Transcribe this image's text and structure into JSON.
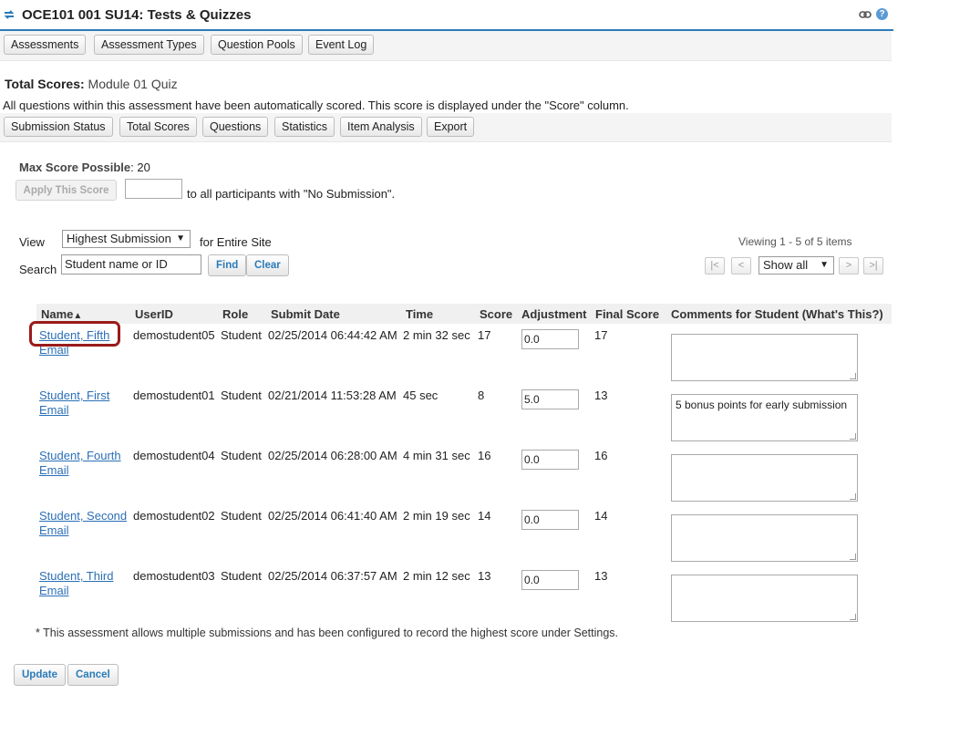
{
  "header": {
    "title": "OCE101 001 SU14: Tests & Quizzes",
    "help_label": "?"
  },
  "nav": {
    "items": [
      "Assessments",
      "Assessment Types",
      "Question Pools",
      "Event Log"
    ]
  },
  "page": {
    "heading_label": "Total Scores:",
    "heading_value": "Module 01 Quiz",
    "info": "All questions within this assessment have been automatically scored. This score is displayed under the \"Score\" column."
  },
  "subnav": {
    "items": [
      "Submission Status",
      "Total Scores",
      "Questions",
      "Statistics",
      "Item Analysis",
      "Export"
    ]
  },
  "scoring": {
    "max_label": "Max Score Possible",
    "max_value": ": 20",
    "apply_button": "Apply This Score",
    "apply_tail": "to all participants with \"No Submission\"."
  },
  "filters": {
    "view_label": "View",
    "view_selected": "Highest Submission",
    "view_tail": "for Entire Site",
    "search_label": "Search",
    "search_value": "Student name or ID",
    "find_button": "Find",
    "clear_button": "Clear"
  },
  "pager": {
    "viewing": "Viewing 1 - 5 of 5 items",
    "first": "|<",
    "prev": "<",
    "show_selected": "Show all",
    "next": ">",
    "last": ">|"
  },
  "table": {
    "columns": [
      "Name",
      "UserID",
      "Role",
      "Submit Date",
      "Time",
      "Score",
      "Adjustment",
      "Final Score",
      "Comments for Student  (What's This?)"
    ],
    "rows": [
      {
        "name": "Student, Fifth",
        "email": "Email",
        "userid": "demostudent05",
        "role": "Student",
        "submit_date": "02/25/2014 06:44:42 AM",
        "time": "2 min 32 sec",
        "score": "17",
        "adjustment": "0.0",
        "final_score": "17",
        "comment": ""
      },
      {
        "name": "Student, First",
        "email": "Email",
        "userid": "demostudent01",
        "role": "Student",
        "submit_date": "02/21/2014 11:53:28 AM",
        "time": "45 sec",
        "score": "8",
        "adjustment": "5.0",
        "final_score": "13",
        "comment": "5 bonus points for early submission"
      },
      {
        "name": "Student, Fourth",
        "email": "Email",
        "userid": "demostudent04",
        "role": "Student",
        "submit_date": "02/25/2014 06:28:00 AM",
        "time": "4 min 31 sec",
        "score": "16",
        "adjustment": "0.0",
        "final_score": "16",
        "comment": ""
      },
      {
        "name": "Student, Second",
        "email": "Email",
        "userid": "demostudent02",
        "role": "Student",
        "submit_date": "02/25/2014 06:41:40 AM",
        "time": "2 min 19 sec",
        "score": "14",
        "adjustment": "0.0",
        "final_score": "14",
        "comment": ""
      },
      {
        "name": "Student, Third",
        "email": "Email",
        "userid": "demostudent03",
        "role": "Student",
        "submit_date": "02/25/2014 06:37:57 AM",
        "time": "2 min 12 sec",
        "score": "13",
        "adjustment": "0.0",
        "final_score": "13",
        "comment": ""
      }
    ]
  },
  "footnote": "* This assessment allows multiple submissions and has been configured to record the highest score under Settings.",
  "actions": {
    "update": "Update",
    "cancel": "Cancel"
  }
}
